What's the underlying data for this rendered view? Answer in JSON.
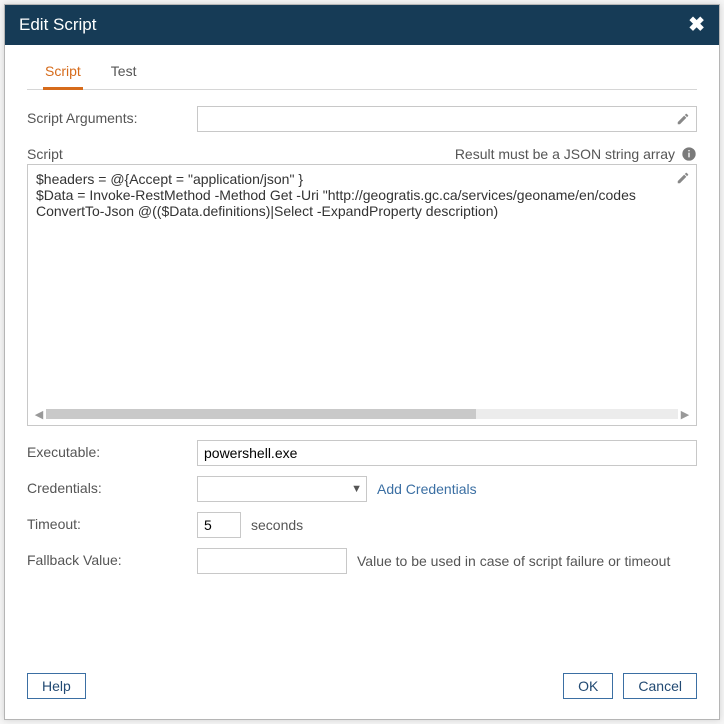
{
  "dialog": {
    "title": "Edit Script"
  },
  "tabs": {
    "script": "Script",
    "test": "Test"
  },
  "labels": {
    "script_arguments": "Script Arguments:",
    "script": "Script",
    "result_hint": "Result must be a JSON string array",
    "executable": "Executable:",
    "credentials": "Credentials:",
    "timeout": "Timeout:",
    "timeout_unit": "seconds",
    "fallback": "Fallback Value:",
    "fallback_desc": "Value to be used in case of script failure or timeout",
    "add_credentials": "Add Credentials"
  },
  "values": {
    "script_arguments": "",
    "script_text": "$headers = @{Accept = \"application/json\" }\n$Data = Invoke-RestMethod -Method Get -Uri \"http://geogratis.gc.ca/services/geoname/en/codes\nConvertTo-Json @(($Data.definitions)|Select -ExpandProperty description)",
    "executable": "powershell.exe",
    "credentials": "",
    "timeout": "5",
    "fallback": ""
  },
  "buttons": {
    "help": "Help",
    "ok": "OK",
    "cancel": "Cancel"
  },
  "icons": {
    "close": "✖",
    "pencil": "pencil-icon",
    "info": "info-icon",
    "caret": "▼",
    "left": "◀",
    "right": "▶"
  }
}
